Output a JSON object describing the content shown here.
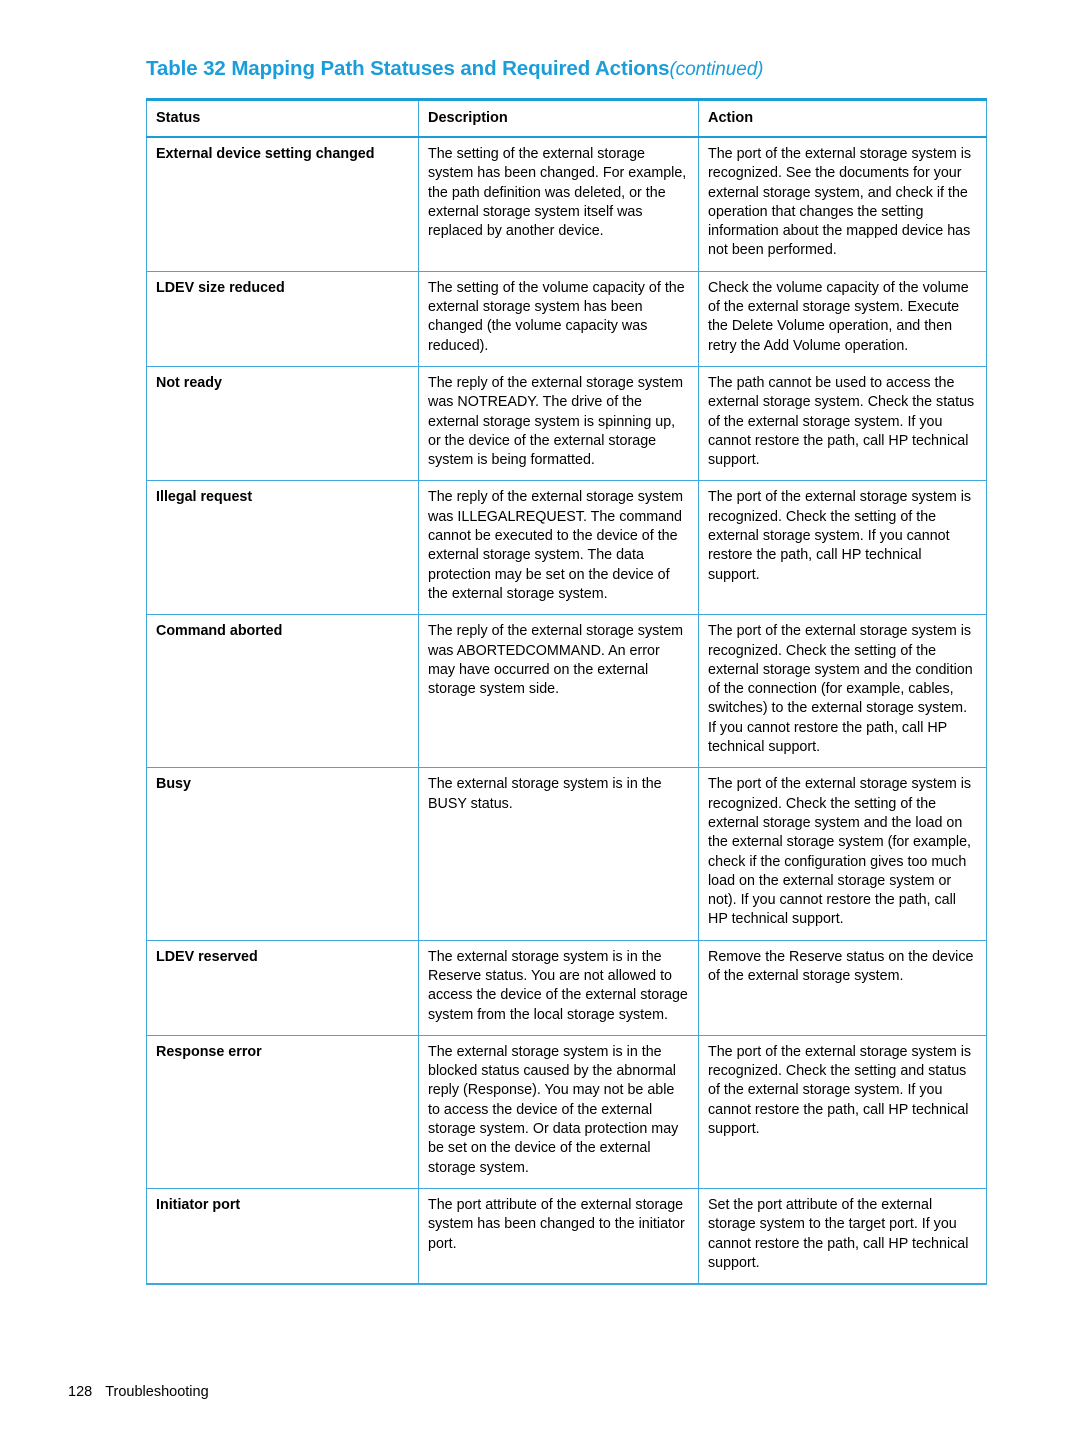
{
  "page": {
    "title_prefix": "Table 32 Mapping Path Statuses and Required Actions",
    "title_continued": "(continued)",
    "accent_color": "#1b9dd9",
    "border_color": "#3fa9dd"
  },
  "table": {
    "headers": {
      "status": "Status",
      "description": "Description",
      "action": "Action"
    },
    "rows": [
      {
        "status": "External device setting changed",
        "description": "The setting of the external storage system has been changed. For example, the path definition was deleted, or the external storage system itself was replaced by another device.",
        "action": "The port of the external storage system is recognized. See the documents for your external storage system, and check if the operation that changes the setting information about the mapped device has not been performed."
      },
      {
        "status": "LDEV size reduced",
        "description": "The setting of the volume capacity of the external storage system has been changed (the volume capacity was reduced).",
        "action": "Check the volume capacity of the volume of the external storage system. Execute the Delete Volume operation, and then retry the Add Volume operation."
      },
      {
        "status": "Not ready",
        "description": "The reply of the external storage system was NOTREADY. The drive of the external storage system is spinning up, or the device of the external storage system is being formatted.",
        "action": "The path cannot be used to access the external storage system. Check the status of the external storage system. If you cannot restore the path, call HP technical support."
      },
      {
        "status": "Illegal request",
        "description": "The reply of the external storage system was ILLEGALREQUEST. The command cannot be executed to the device of the external storage system. The data protection may be set on the device of the external storage system.",
        "action": "The port of the external storage system is recognized. Check the setting of the external storage system. If you cannot restore the path, call HP technical support."
      },
      {
        "status": "Command aborted",
        "description": "The reply of the external storage system was ABORTEDCOMMAND. An error may have occurred on the external storage system side.",
        "action": "The port of the external storage system is recognized. Check the setting of the external storage system and the condition of the connection (for example, cables, switches) to the external storage system. If you cannot restore the path, call HP technical support."
      },
      {
        "status": "Busy",
        "description": "The external storage system is in the BUSY status.",
        "action": "The port of the external storage system is recognized. Check the setting of the external storage system and the load on the external storage system (for example, check if the configuration gives too much load on the external storage system or not). If you cannot restore the path, call HP technical support."
      },
      {
        "status": "LDEV reserved",
        "description": "The external storage system is in the Reserve status. You are not allowed to access the device of the external storage system from the local storage system.",
        "action": "Remove the Reserve status on the device of the external storage system."
      },
      {
        "status": "Response error",
        "description": "The external storage system is in the blocked status caused by the abnormal reply (Response). You may not be able to access the device of the external storage system. Or data protection may be set on the device of the external storage system.",
        "action": "The port of the external storage system is recognized. Check the setting and status of the external storage system. If you cannot restore the path, call HP technical support."
      },
      {
        "status": "Initiator port",
        "description": "The port attribute of the external storage system has been changed to the initiator port.",
        "action": "Set the port attribute of the external storage system to the target port. If you cannot restore the path, call HP technical support."
      }
    ]
  },
  "footer": {
    "page_number": "128",
    "section": "Troubleshooting"
  }
}
